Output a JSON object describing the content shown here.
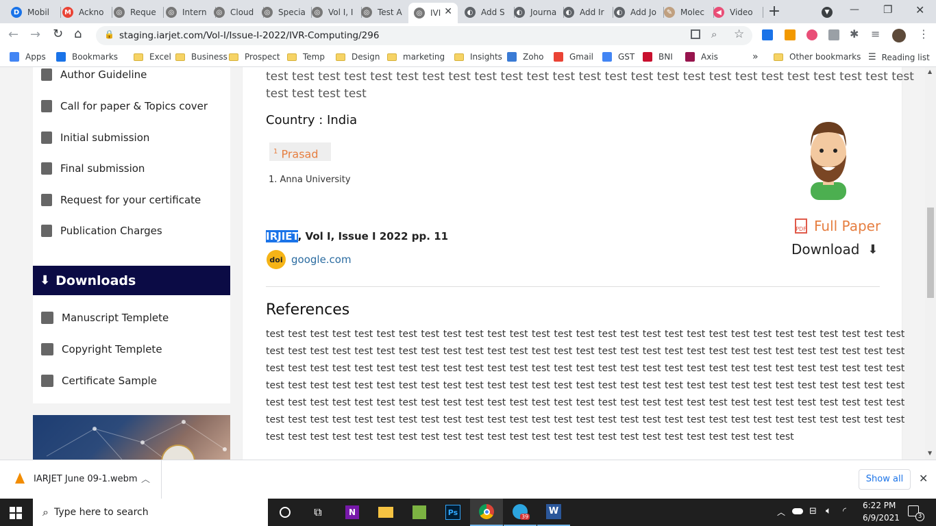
{
  "tabs": [
    {
      "label": "Mobil",
      "fav_color": "#1a73e8",
      "fav_char": "D"
    },
    {
      "label": "Ackno",
      "fav_color": "#ea4335",
      "fav_char": "M"
    },
    {
      "label": "Reque",
      "fav_color": "#777",
      "fav_char": "◎"
    },
    {
      "label": "Intern",
      "fav_color": "#777",
      "fav_char": "◎"
    },
    {
      "label": "Cloud",
      "fav_color": "#777",
      "fav_char": "◎"
    },
    {
      "label": "Specia",
      "fav_color": "#777",
      "fav_char": "◎"
    },
    {
      "label": "Vol I, I",
      "fav_color": "#777",
      "fav_char": "◎"
    },
    {
      "label": "Test A",
      "fav_color": "#777",
      "fav_char": "◎"
    },
    {
      "label": "IVI",
      "fav_color": "#777",
      "fav_char": "◎",
      "active": true
    },
    {
      "label": "Add S",
      "fav_color": "#5f6368",
      "fav_char": "◐"
    },
    {
      "label": "Journa",
      "fav_color": "#5f6368",
      "fav_char": "◐"
    },
    {
      "label": "Add Ir",
      "fav_color": "#5f6368",
      "fav_char": "◐"
    },
    {
      "label": "Add Jo",
      "fav_color": "#5f6368",
      "fav_char": "◐"
    },
    {
      "label": "Molec",
      "fav_color": "#c0a080",
      "fav_char": "✎"
    },
    {
      "label": "Video",
      "fav_color": "#e94e77",
      "fav_char": "◀"
    }
  ],
  "toolbar": {
    "url": "staging.iarjet.com/Vol-I/Issue-I-2022/IVR-Computing/296",
    "new_tab": "+",
    "minimize": "—",
    "restore": "❐",
    "close": "✕"
  },
  "bookmarks": [
    {
      "label": "Apps",
      "type": "apps"
    },
    {
      "label": "Bookmarks",
      "type": "star"
    },
    {
      "label": "Excel",
      "type": "folder"
    },
    {
      "label": "Business",
      "type": "folder"
    },
    {
      "label": "Prospect",
      "type": "folder"
    },
    {
      "label": "Temp",
      "type": "folder"
    },
    {
      "label": "Design",
      "type": "folder"
    },
    {
      "label": "marketing",
      "type": "folder"
    },
    {
      "label": "Insights",
      "type": "folder"
    },
    {
      "label": "Zoho",
      "type": "zoho"
    },
    {
      "label": "Gmail",
      "type": "gmail"
    },
    {
      "label": "GST",
      "type": "google"
    },
    {
      "label": "BNI",
      "type": "bni"
    },
    {
      "label": "Axis",
      "type": "axis"
    }
  ],
  "bookmarks_more": "»",
  "other_bookmarks": "Other bookmarks",
  "reading_list": "Reading list",
  "sidebar": {
    "items": [
      {
        "label": "Author Guideline"
      },
      {
        "label": "Call for paper & Topics cover"
      },
      {
        "label": "Initial submission"
      },
      {
        "label": "Final submission"
      },
      {
        "label": "Request for your certificate"
      },
      {
        "label": "Publication Charges"
      }
    ],
    "downloads_heading": "Downloads",
    "download_items": [
      {
        "label": "Manuscript Templete"
      },
      {
        "label": "Copyright Templete"
      },
      {
        "label": "Certificate Sample"
      }
    ]
  },
  "article": {
    "abstract_line1": "test test test test test test test test test test test test test test test test test test test test test test test test test",
    "abstract_line2": "test test test test",
    "country": "Country : India",
    "author_sup": "1",
    "author": "Prasad",
    "affiliation": "1. Anna University",
    "citation_highlight": "IRJIET",
    "citation_rest": ", Vol I, Issue I 2022 pp. 11",
    "doi_badge": "doi",
    "doi_link": "google.com",
    "full_paper": "Full Paper",
    "download": "Download",
    "references_heading": "References",
    "references_lines": [
      "test test test test test test test test test test test test test test test test test test test test test test test test test test test test test",
      "test test test test test test test test test test test test test test test test test test test test test test test test test test test test test",
      "test test test test test test test test test test test test test test test test test test test test test test test test test test test test test",
      "test test test test test test test test test test test test test test test test test test test test test test test test test test test test test",
      "test test test test test test test test test test test test test test test test test test test test test test test test test test test test test",
      "test test test test test test test test test test test test test test test test test test test test test test test test test test test test test",
      "test test test test test test test test test test test test test test test test test test test test test test test test"
    ]
  },
  "download_bar": {
    "file_name": "IARJET June 09-1.webm",
    "show_all": "Show all",
    "close": "✕"
  },
  "taskbar": {
    "search_placeholder": "Type here to search",
    "time": "6:22 PM",
    "date": "6/9/2021",
    "notifications": "3",
    "telegram_badge": "39"
  }
}
